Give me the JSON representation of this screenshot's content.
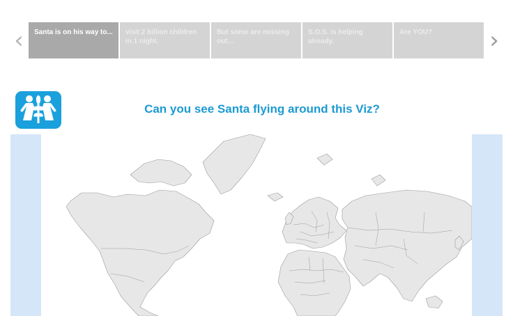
{
  "story": {
    "prev_icon": "chevron-left-icon",
    "next_icon": "chevron-right-icon",
    "prev_glyph": "‹",
    "next_glyph": "›",
    "points": [
      {
        "label": "Santa is on his way to..."
      },
      {
        "label": "visit 2 billion children in 1 night."
      },
      {
        "label": "But some are missing out..."
      },
      {
        "label": "S.O.S. is helping already."
      },
      {
        "label": "Are YOU?"
      }
    ],
    "active_index": 0
  },
  "logo": {
    "icon": "sos-children-logo-icon",
    "color": "#1aa0dc"
  },
  "headline": "Can you see Santa flying around this Viz?",
  "map": {
    "land_color": "#e7e7e7",
    "border_color": "#9a9a9a",
    "side_band_color": "#d5e6f9"
  }
}
